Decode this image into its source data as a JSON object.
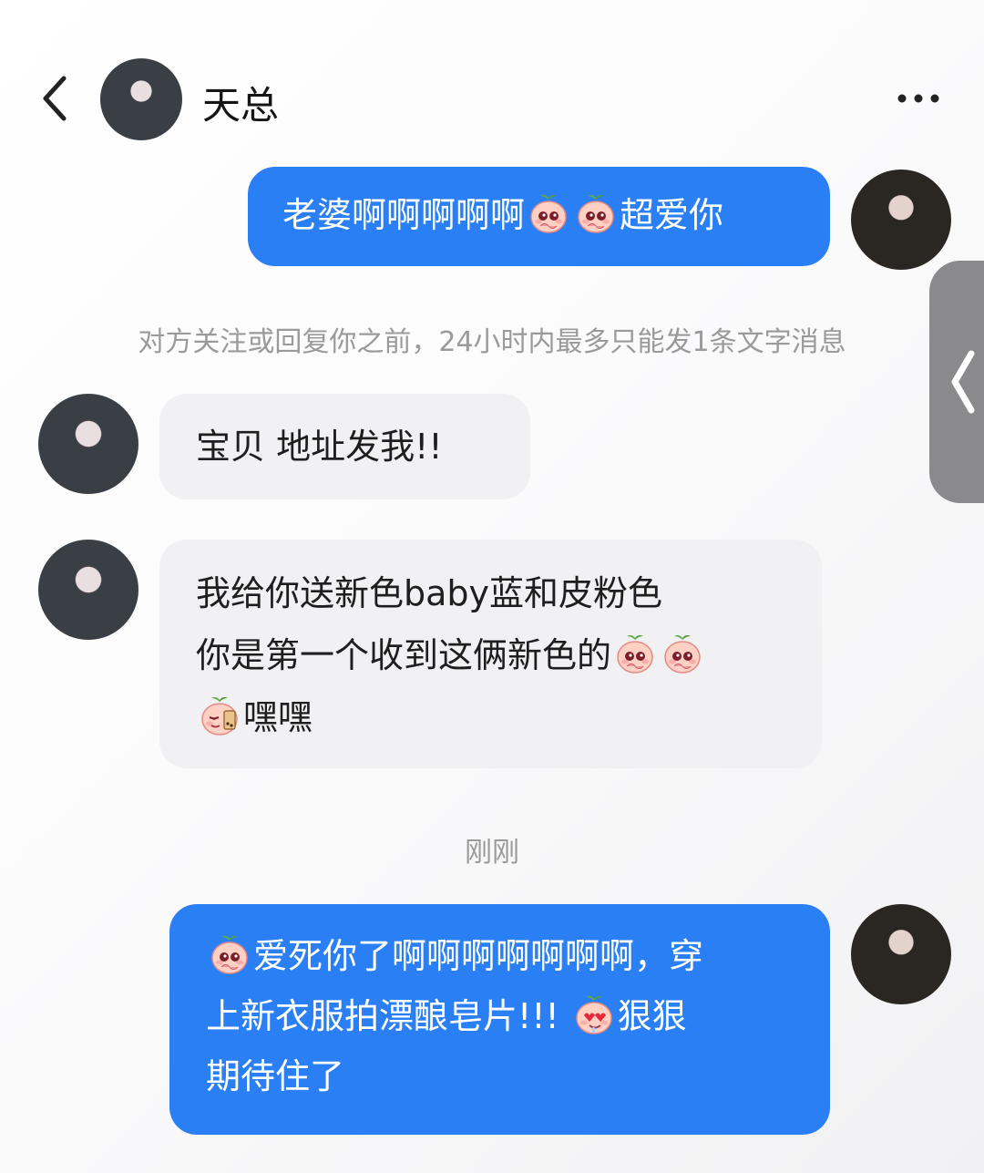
{
  "header": {
    "contact_name": "天总",
    "back_icon": "chevron-left-icon",
    "more_icon": "more-horizontal-icon"
  },
  "messages": [
    {
      "sender": "me",
      "lines": [
        [
          "老婆啊啊啊啊啊",
          "emoji:peach-pleading",
          "emoji:peach-pleading",
          "超爱你"
        ]
      ]
    },
    {
      "sender": "them",
      "lines": [
        [
          "宝贝 地址发我!!"
        ]
      ]
    },
    {
      "sender": "them",
      "lines": [
        [
          "我给你送新色baby蓝和皮粉色"
        ],
        [
          "你是第一个收到这俩新色的",
          "emoji:peach-pleading",
          "emoji:peach-pleading"
        ],
        [
          "emoji:peach-milktea",
          "嘿嘿"
        ]
      ]
    },
    {
      "sender": "me",
      "lines": [
        [
          "emoji:peach-pleading",
          "爱死你了啊啊啊啊啊啊啊，穿"
        ],
        [
          "上新衣服拍漂酿皂片!!! ",
          "emoji:peach-heart-eyes",
          "狠狠"
        ],
        [
          "期待住了"
        ]
      ]
    }
  ],
  "system": {
    "limit_notice": "对方关注或回复你之前，24小时内最多只能发1条文字消息",
    "timestamp": "刚刚"
  },
  "colors": {
    "my_bubble": "#2a7ff4",
    "their_bubble": "#f1f1f3",
    "hint_text": "#9a9a9a",
    "side_tab": "#8a8a8c"
  },
  "side_tab_icon": "chevron-left-icon"
}
